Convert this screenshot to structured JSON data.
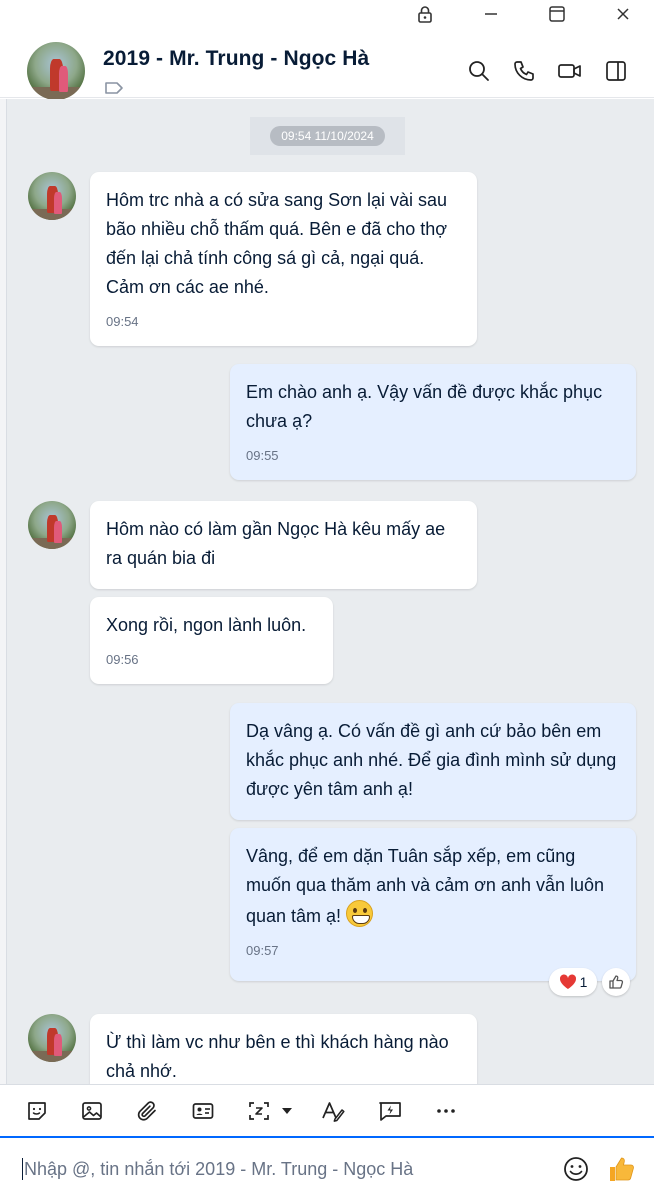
{
  "window": {
    "controls": [
      "lock-icon",
      "minimize-icon",
      "maximize-icon",
      "close-icon"
    ]
  },
  "header": {
    "title": "2019 - Mr. Trung - Ngọc Hà",
    "icons": [
      "search-icon",
      "phone-icon",
      "video-icon",
      "sidebar-icon"
    ]
  },
  "chat": {
    "date_label": "09:54 11/10/2024",
    "messages": [
      {
        "side": "in",
        "text": "Hôm trc nhà a có sửa sang Sơn lại vài sau bão nhiều chỗ thấm quá. Bên e đã cho thợ đến lại chả tính công sá gì cả, ngại quá. Cảm ơn các ae nhé.",
        "time": "09:54"
      },
      {
        "side": "out",
        "text": "Em chào anh ạ. Vậy vấn đề được khắc phục chưa ạ?",
        "time": "09:55"
      },
      {
        "side": "in",
        "text": "Hôm nào có làm gần Ngọc Hà kêu mấy ae ra quán bia đi",
        "time": ""
      },
      {
        "side": "in",
        "text": "Xong rồi, ngon lành luôn.",
        "time": "09:56"
      },
      {
        "side": "out",
        "text": "Dạ vâng ạ. Có vấn đề gì anh cứ bảo bên em khắc phục anh nhé. Để gia đình mình sử dụng được yên tâm anh ạ!",
        "time": ""
      },
      {
        "side": "out",
        "text": "Vâng, để em dặn Tuân sắp xếp, em cũng muốn qua thăm anh và cảm ơn anh vẫn luôn quan tâm ạ!",
        "time": "09:57",
        "emoji": "grinning-face-emoji"
      },
      {
        "side": "in",
        "text": "Ừ thì làm vc như bên e thì khách hàng nào chả nhớ.",
        "time": ""
      }
    ],
    "reaction": {
      "emoji": "heart",
      "count": "1",
      "color": "#e53935"
    }
  },
  "toolbar": {
    "icons": [
      "sticker-icon",
      "image-icon",
      "attachment-icon",
      "contact-card-icon",
      "screenshot-icon",
      "dropdown-arrow-icon",
      "text-format-icon",
      "quick-message-icon",
      "more-icon"
    ]
  },
  "input": {
    "placeholder": "Nhập @, tin nhắn tới 2019 - Mr. Trung - Ngọc Hà",
    "value": ""
  },
  "colors": {
    "accent": "#0068ff",
    "chat_bg": "#e9ecef",
    "incoming_bubble": "#ffffff",
    "outgoing_bubble": "#e5efff",
    "like": "#f5a623"
  }
}
